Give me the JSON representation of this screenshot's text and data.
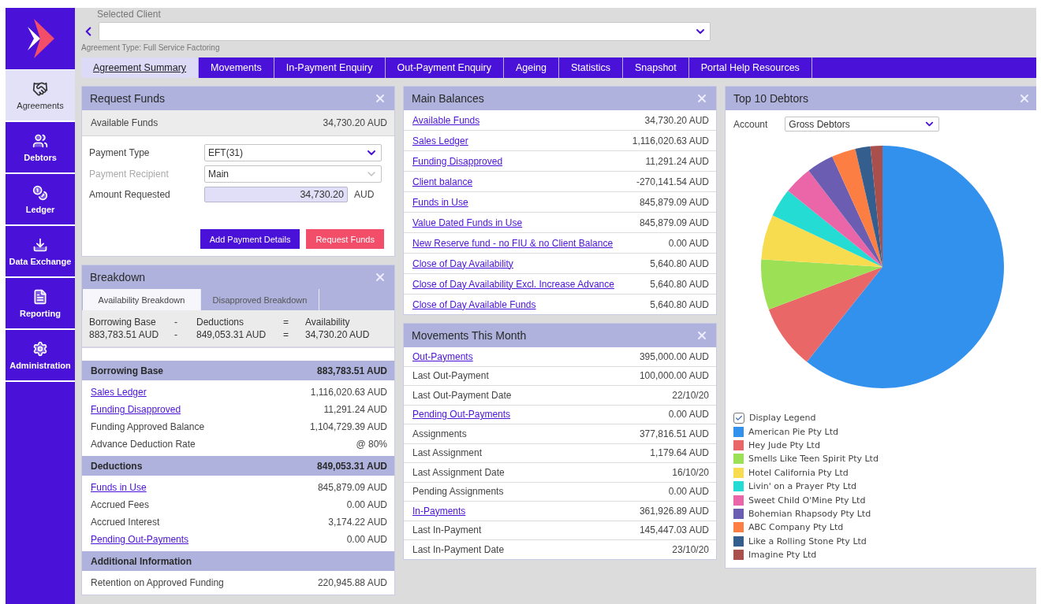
{
  "sidebar": {
    "items": [
      {
        "label": "Agreements",
        "selected": true
      },
      {
        "label": "Debtors",
        "selected": false
      },
      {
        "label": "Ledger",
        "selected": false
      },
      {
        "label": "Data Exchange",
        "selected": false
      },
      {
        "label": "Reporting",
        "selected": false
      },
      {
        "label": "Administration",
        "selected": false
      }
    ]
  },
  "header": {
    "label": "Selected Client",
    "agreement_type": "Agreement Type: Full Service Factoring"
  },
  "tabs": [
    {
      "label": "Agreement Summary",
      "selected": true
    },
    {
      "label": "Movements",
      "selected": false
    },
    {
      "label": "In-Payment Enquiry",
      "selected": false
    },
    {
      "label": "Out-Payment Enquiry",
      "selected": false
    },
    {
      "label": "Ageing",
      "selected": false
    },
    {
      "label": "Statistics",
      "selected": false
    },
    {
      "label": "Snapshot",
      "selected": false
    },
    {
      "label": "Portal Help Resources",
      "selected": false
    }
  ],
  "request_funds": {
    "title": "Request Funds",
    "available": {
      "label": "Available Funds",
      "value": "34,730.20 AUD"
    },
    "fields": [
      {
        "kind": "select",
        "label": "Payment Type",
        "value": "EFT(31)",
        "disabled": false
      },
      {
        "kind": "select",
        "label": "Payment Recipient",
        "value": "Main",
        "disabled": true
      },
      {
        "kind": "amount",
        "label": "Amount Requested",
        "value": "34,730.20",
        "unit": "AUD",
        "disabled": false
      }
    ],
    "buttons": [
      {
        "label": "Add Payment Details",
        "kind": "primary"
      },
      {
        "label": "Request Funds",
        "kind": "danger"
      }
    ]
  },
  "breakdown": {
    "title": "Breakdown",
    "tabs": [
      {
        "label": "Availability Breakdown",
        "selected": true
      },
      {
        "label": "Disapproved Breakdown",
        "selected": false
      }
    ],
    "summary": [
      [
        "Borrowing Base",
        "-",
        "Deductions",
        "=",
        "Availability"
      ],
      [
        "883,783.51 AUD",
        "-",
        "849,053.31 AUD",
        "=",
        "34,730.20 AUD"
      ]
    ],
    "sections": [
      {
        "title": "Borrowing Base",
        "total": "883,783.51 AUD",
        "rows": [
          {
            "kind": "link",
            "label": "Sales Ledger",
            "value": "1,116,020.63 AUD"
          },
          {
            "kind": "link",
            "label": "Funding Disapproved",
            "value": "11,291.24 AUD"
          },
          {
            "kind": "text",
            "label": "Funding Approved Balance",
            "value": "1,104,729.39 AUD"
          },
          {
            "kind": "text",
            "label": "Advance Deduction Rate",
            "value": "@ 80%"
          }
        ]
      },
      {
        "title": "Deductions",
        "total": "849,053.31 AUD",
        "rows": [
          {
            "kind": "link",
            "label": "Funds in Use",
            "value": "845,879.09 AUD"
          },
          {
            "kind": "text",
            "label": "Accrued Fees",
            "value": "0.00 AUD"
          },
          {
            "kind": "text",
            "label": "Accrued Interest",
            "value": "3,174.22 AUD"
          },
          {
            "kind": "link",
            "label": "Pending Out-Payments",
            "value": "0.00 AUD"
          }
        ]
      },
      {
        "title": "Additional Information",
        "rows": [
          {
            "kind": "text",
            "label": "Retention on Approved Funding",
            "value": "220,945.88 AUD"
          }
        ]
      }
    ]
  },
  "main_balances": {
    "title": "Main Balances",
    "rows": [
      {
        "kind": "link",
        "label": "Available Funds",
        "value": "34,730.20 AUD"
      },
      {
        "kind": "link",
        "label": "Sales Ledger",
        "value": "1,116,020.63 AUD"
      },
      {
        "kind": "link",
        "label": "Funding Disapproved",
        "value": "11,291.24 AUD"
      },
      {
        "kind": "link",
        "label": "Client balance",
        "value": "-270,141.54 AUD"
      },
      {
        "kind": "link",
        "label": "Funds in Use",
        "value": "845,879.09 AUD"
      },
      {
        "kind": "link",
        "label": "Value Dated Funds in Use",
        "value": "845,879.09 AUD"
      },
      {
        "kind": "link",
        "label": "New Reserve fund - no FIU & no Client Balance",
        "value": "0.00 AUD"
      },
      {
        "kind": "link",
        "label": "Close of Day Availability",
        "value": "5,640.80 AUD"
      },
      {
        "kind": "link",
        "label": "Close of Day Availability Excl. Increase Advance",
        "value": "5,640.80 AUD"
      },
      {
        "kind": "link",
        "label": "Close of Day Available Funds",
        "value": "5,640.80 AUD"
      }
    ]
  },
  "movements": {
    "title": "Movements This Month",
    "rows": [
      {
        "kind": "link",
        "label": "Out-Payments",
        "value": "395,000.00 AUD"
      },
      {
        "kind": "text",
        "label": "Last Out-Payment",
        "value": "100,000.00 AUD"
      },
      {
        "kind": "text",
        "label": "Last Out-Payment Date",
        "value": "22/10/20"
      },
      {
        "kind": "link",
        "label": "Pending Out-Payments",
        "value": "0.00 AUD"
      },
      {
        "kind": "text",
        "label": "Assignments",
        "value": "377,816.51 AUD"
      },
      {
        "kind": "text",
        "label": "Last Assignment",
        "value": "1,179.64 AUD"
      },
      {
        "kind": "text",
        "label": "Last Assignment Date",
        "value": "16/10/20"
      },
      {
        "kind": "text",
        "label": "Pending Assignments",
        "value": "0.00 AUD"
      },
      {
        "kind": "link",
        "label": "In-Payments",
        "value": "361,926.89 AUD"
      },
      {
        "kind": "text",
        "label": "Last In-Payment",
        "value": "145,447.03 AUD"
      },
      {
        "kind": "text",
        "label": "Last In-Payment Date",
        "value": "23/10/20"
      }
    ]
  },
  "top_debtors": {
    "title": "Top 10 Debtors",
    "account_label": "Account",
    "account_value": "Gross Debtors",
    "legend_toggle": {
      "label": "Display Legend",
      "checked": true
    },
    "legend": [
      {
        "name": "American Pie Pty Ltd",
        "color": "#3291ec"
      },
      {
        "name": "Hey Jude Pty Ltd",
        "color": "#ea6767"
      },
      {
        "name": "Smells Like Teen Spirit Pty Ltd",
        "color": "#9be055"
      },
      {
        "name": "Hotel California Pty Ltd",
        "color": "#f7dc50"
      },
      {
        "name": "Livin' on a Prayer Pty Ltd",
        "color": "#25dcd4"
      },
      {
        "name": "Sweet Child O'Mine Pty Ltd",
        "color": "#ea66a8"
      },
      {
        "name": "Bohemian Rhapsody Pty Ltd",
        "color": "#6a5db2"
      },
      {
        "name": "ABC Company Pty Ltd",
        "color": "#fd7e42"
      },
      {
        "name": "Like a Rolling Stone Pty Ltd",
        "color": "#335e8e"
      },
      {
        "name": "Imagine Pty Ltd",
        "color": "#a9504d"
      }
    ]
  }
}
